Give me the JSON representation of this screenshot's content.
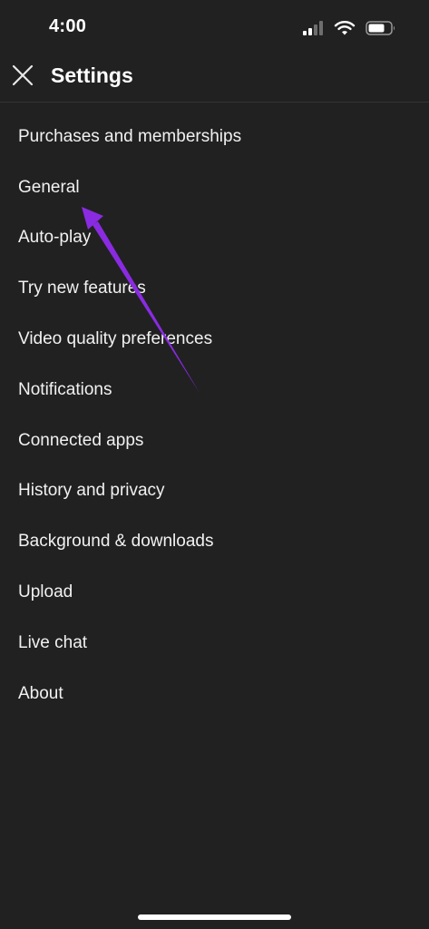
{
  "status_bar": {
    "time": "4:00",
    "icons": [
      "signal-icon",
      "wifi-icon",
      "battery-icon"
    ]
  },
  "header": {
    "close_icon": "close-icon",
    "title": "Settings"
  },
  "settings": {
    "items": [
      {
        "label": "Purchases and memberships"
      },
      {
        "label": "General"
      },
      {
        "label": "Auto-play"
      },
      {
        "label": "Try new features"
      },
      {
        "label": "Video quality preferences"
      },
      {
        "label": "Notifications"
      },
      {
        "label": "Connected apps"
      },
      {
        "label": "History and privacy"
      },
      {
        "label": "Background & downloads"
      },
      {
        "label": "Upload"
      },
      {
        "label": "Live chat"
      },
      {
        "label": "About"
      }
    ]
  },
  "annotation": {
    "arrow_color": "#8a2be2",
    "points_to": "General"
  },
  "colors": {
    "background": "#212121",
    "text": "#f1f1f1",
    "divider": "#333333"
  }
}
